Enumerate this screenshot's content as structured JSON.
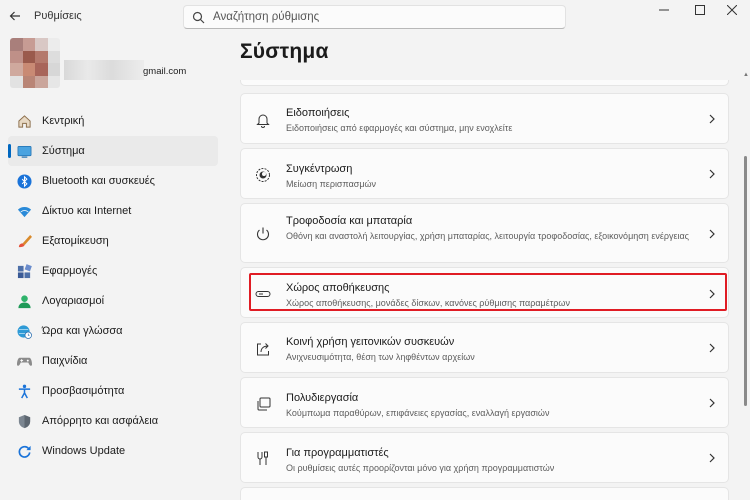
{
  "window": {
    "title": "Ρυθμίσεις",
    "controls": [
      "minimize",
      "maximize",
      "close"
    ]
  },
  "search": {
    "placeholder": "Αναζήτηση ρύθμισης"
  },
  "account": {
    "email": "gmail.com"
  },
  "sidebar": {
    "items": [
      {
        "label": "Κεντρική",
        "icon": "home-icon"
      },
      {
        "label": "Σύστημα",
        "icon": "system-icon",
        "active": true
      },
      {
        "label": "Bluetooth και συσκευές",
        "icon": "bluetooth-icon"
      },
      {
        "label": "Δίκτυο και Internet",
        "icon": "wifi-icon"
      },
      {
        "label": "Εξατομίκευση",
        "icon": "brush-icon"
      },
      {
        "label": "Εφαρμογές",
        "icon": "apps-icon"
      },
      {
        "label": "Λογαριασμοί",
        "icon": "person-icon"
      },
      {
        "label": "Ώρα και γλώσσα",
        "icon": "globe-clock-icon"
      },
      {
        "label": "Παιχνίδια",
        "icon": "gamepad-icon"
      },
      {
        "label": "Προσβασιμότητα",
        "icon": "accessibility-icon"
      },
      {
        "label": "Απόρρητο και ασφάλεια",
        "icon": "shield-icon"
      },
      {
        "label": "Windows Update",
        "icon": "update-icon"
      }
    ]
  },
  "main": {
    "title": "Σύστημα",
    "cards": [
      {
        "title": "Ειδοποιήσεις",
        "subtitle": "Ειδοποιήσεις από εφαρμογές και σύστημα, μην ενοχλείτε",
        "icon": "bell-icon"
      },
      {
        "title": "Συγκέντρωση",
        "subtitle": "Μείωση περισπασμών",
        "icon": "focus-icon"
      },
      {
        "title": "Τροφοδοσία και μπαταρία",
        "subtitle": "Οθόνη και αναστολή λειτουργίας, χρήση μπαταρίας, λειτουργία τροφοδοσίας, εξοικονόμηση ενέργειας",
        "icon": "power-icon"
      },
      {
        "title": "Χώρος αποθήκευσης",
        "subtitle": "Χώρος αποθήκευσης, μονάδες δίσκων, κανόνες ρύθμισης παραμέτρων",
        "icon": "storage-icon",
        "highlighted": true
      },
      {
        "title": "Κοινή χρήση γειτονικών συσκευών",
        "subtitle": "Ανιχνευσιμότητα, θέση των ληφθέντων αρχείων",
        "icon": "share-icon"
      },
      {
        "title": "Πολυδιεργασία",
        "subtitle": "Κούμπωμα παραθύρων, επιφάνειες εργασίας, εναλλαγή εργασιών",
        "icon": "multitask-icon"
      },
      {
        "title": "Για προγραμματιστές",
        "subtitle": "Οι ρυθμίσεις αυτές προορίζονται μόνο για χρήση προγραμματιστών",
        "icon": "developer-icon"
      }
    ]
  },
  "colors": {
    "accent": "#0067c0",
    "highlight_border": "#e01c24"
  }
}
